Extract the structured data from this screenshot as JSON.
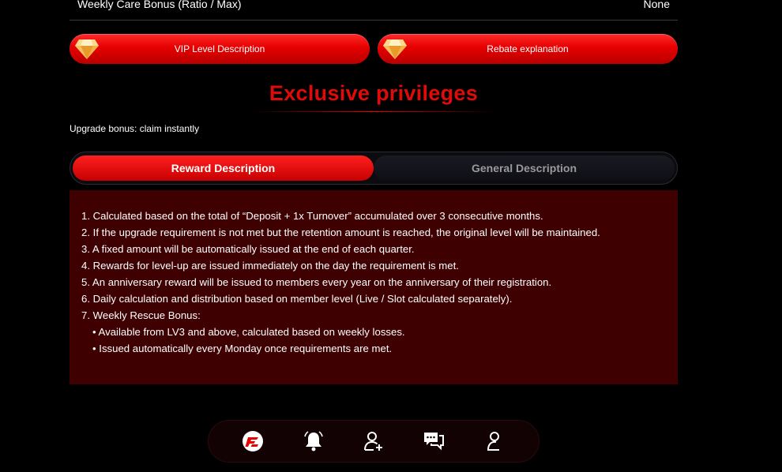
{
  "top_row": {
    "label": "Weekly Care Bonus (Ratio / Max)",
    "value": "None"
  },
  "buttons": {
    "vip_level": "VIP Level Description",
    "rebate": "Rebate explanation"
  },
  "section_title": "Exclusive privileges",
  "upgrade_note": "Upgrade bonus: claim instantly",
  "tabs": {
    "reward": "Reward Description",
    "general": "General Description"
  },
  "reward_items": [
    "1. Calculated based on the total of “Deposit + 1x Turnover” accumulated over 3 consecutive months.",
    "2. If the upgrade requirement is not met but the retention amount is reached, the original level will be maintained.",
    "3. A fixed amount will be automatically issued at the end of each quarter.",
    "4. Rewards for level-up are issued immediately on the day the requirement is met.",
    "5. An anniversary reward will be issued to members every year on the anniversary of their registration.",
    "6. Daily calculation and distribution based on member level (Live / Slot calculated separately).",
    "7. Weekly Rescue Bonus:"
  ],
  "reward_subitems": [
    "• Available from LV3 and above, calculated based on weekly losses.",
    "• Issued automatically every Monday once requirements are met."
  ],
  "nav_icons": [
    "brand-logo-icon",
    "bell-icon",
    "add-user-icon",
    "chat-icon",
    "profile-icon"
  ],
  "colors": {
    "accent": "#e60000",
    "panel_bg": "#3e0000",
    "title": "#e10a0a"
  }
}
